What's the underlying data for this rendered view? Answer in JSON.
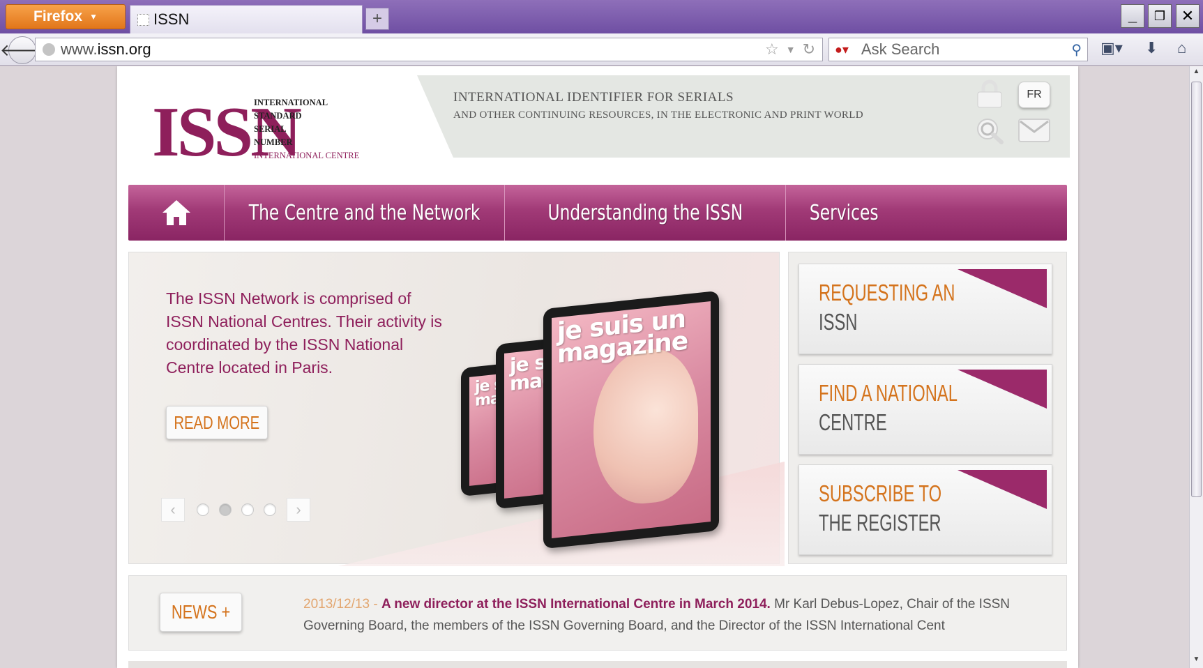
{
  "browser": {
    "app_button": "Firefox",
    "tab_title": "ISSN",
    "new_tab": "+",
    "url_prefix": "www.",
    "url_domain": "issn.org",
    "search_placeholder": "Ask Search",
    "window_controls": [
      "_",
      "❐",
      "✕"
    ]
  },
  "header": {
    "logo_mark": "ISSN",
    "logo_lines": [
      "INTERNATIONAL",
      "STANDARD",
      "SERIAL",
      "NUMBER"
    ],
    "logo_centre": "INTERNATIONAL CENTRE",
    "tagline1": "INTERNATIONAL IDENTIFIER FOR SERIALS",
    "tagline2": "AND OTHER CONTINUING RESOURCES, IN THE ELECTRONIC AND PRINT WORLD",
    "lang_button": "FR",
    "icons": [
      "lock-icon",
      "search-icon",
      "mail-icon"
    ]
  },
  "nav": {
    "home_icon": "home-icon",
    "items": [
      "The Centre and the Network",
      "Understanding the ISSN",
      "Services"
    ]
  },
  "slider": {
    "text": "The ISSN Network is comprised of ISSN National Centres. Their activity is coordinated by the ISSN National Centre located in Paris.",
    "read_more": "READ MORE",
    "dots": 4,
    "active_dot": 2,
    "magazine_title": "je suis un magazine"
  },
  "tiles": [
    {
      "line1": "REQUESTING AN",
      "line2": "ISSN"
    },
    {
      "line1": "FIND A NATIONAL",
      "line2": "CENTRE"
    },
    {
      "line1": "SUBSCRIBE TO",
      "line2": "THE REGISTER"
    }
  ],
  "news": {
    "button": "NEWS +",
    "date": "2013/12/13",
    "separator": " - ",
    "headline": "A new director at the ISSN International Centre in March 2014.",
    "body": " Mr Karl Debus-Lopez, Chair of the ISSN Governing Board, the members of the ISSN Governing Board, and the Director of the ISSN International Cent"
  },
  "colors": {
    "brand": "#8e1f5b",
    "accent": "#d4731c",
    "nav_top": "#c4649a",
    "nav_bottom": "#8a2563"
  }
}
